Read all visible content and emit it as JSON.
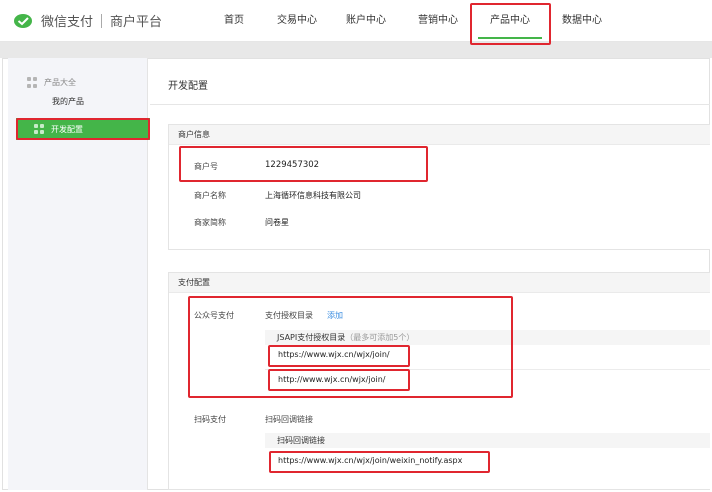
{
  "header": {
    "logo_text": "微信支付",
    "logo_subtitle": "商户平台",
    "nav": [
      {
        "label": "首页"
      },
      {
        "label": "交易中心"
      },
      {
        "label": "账户中心"
      },
      {
        "label": "营销中心"
      },
      {
        "label": "产品中心"
      },
      {
        "label": "数据中心"
      }
    ],
    "active_nav": "产品中心"
  },
  "sidebar": {
    "group_label": "产品大全",
    "item_label": "我的产品",
    "active_item": "开发配置"
  },
  "main": {
    "title": "开发配置",
    "merchant_info": {
      "heading": "商户信息",
      "fields": [
        {
          "label": "商户号",
          "value": "1229457302"
        },
        {
          "label": "商户名称",
          "value": "上海循环信息科技有限公司"
        },
        {
          "label": "商家简称",
          "value": "问卷星"
        }
      ]
    },
    "payment_config": {
      "heading": "支付配置",
      "official_account": {
        "label": "公众号支付",
        "dir_label": "支付授权目录",
        "add_link": "添加",
        "list_header": "JSAPI支付授权目录",
        "list_note": "（最多可添加5个）",
        "urls": [
          "https://www.wjx.cn/wjx/join/",
          "http://www.wjx.cn/wjx/join/"
        ]
      },
      "scan_pay": {
        "label": "扫码支付",
        "callback_label": "扫码回调链接",
        "list_header": "扫码回调链接",
        "url": "https://www.wjx.cn/wjx/join/weixin_notify.aspx"
      }
    }
  },
  "colors": {
    "accent": "#44b549",
    "highlight": "#e0262f",
    "link": "#3a8de0"
  }
}
